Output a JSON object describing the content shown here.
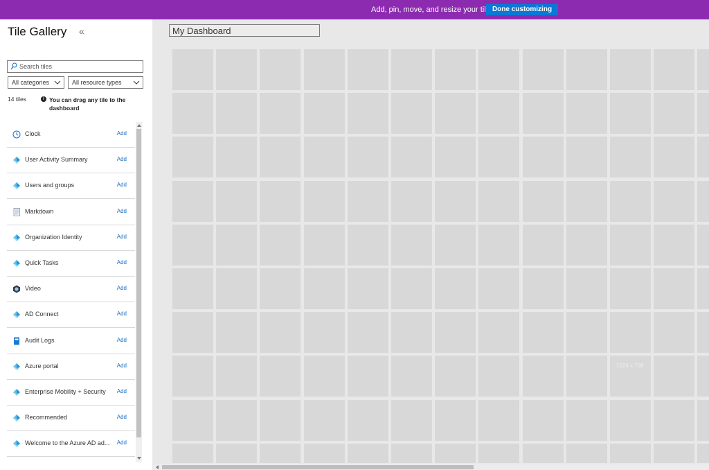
{
  "topbar": {
    "message": "Add, pin, move, and resize your tiles.",
    "done_label": "Done customizing"
  },
  "panel": {
    "title": "Tile Gallery",
    "collapse_glyph": "«",
    "search_placeholder": "Search tiles",
    "category_filter": "All categories",
    "resource_filter": "All resource types",
    "count": "14 tiles",
    "info_text": "You can drag any tile to the dashboard"
  },
  "tiles": [
    {
      "name": "Clock",
      "icon": "clock-icon",
      "add": "Add"
    },
    {
      "name": "User Activity Summary",
      "icon": "azure-ad-icon",
      "add": "Add"
    },
    {
      "name": "Users and groups",
      "icon": "azure-ad-icon",
      "add": "Add"
    },
    {
      "name": "Markdown",
      "icon": "document-icon",
      "add": "Add"
    },
    {
      "name": "Organization Identity",
      "icon": "azure-ad-icon",
      "add": "Add"
    },
    {
      "name": "Quick Tasks",
      "icon": "azure-ad-icon",
      "add": "Add"
    },
    {
      "name": "Video",
      "icon": "video-icon",
      "add": "Add"
    },
    {
      "name": "AD Connect",
      "icon": "azure-ad-icon",
      "add": "Add"
    },
    {
      "name": "Audit Logs",
      "icon": "book-icon",
      "add": "Add"
    },
    {
      "name": "Azure portal",
      "icon": "azure-ad-icon",
      "add": "Add"
    },
    {
      "name": "Enterprise Mobility + Security",
      "icon": "azure-ad-icon",
      "add": "Add"
    },
    {
      "name": "Recommended",
      "icon": "azure-ad-icon",
      "add": "Add"
    },
    {
      "name": "Welcome to the Azure AD ad...",
      "icon": "azure-ad-icon",
      "add": "Add"
    }
  ],
  "dashboard": {
    "title": "My Dashboard",
    "size_label": "1024 x 768"
  },
  "colors": {
    "topbar": "#8c2bb0",
    "done_button": "#0a78d7",
    "link": "#1a6fc4",
    "grid_cell": "#d8d8d8"
  }
}
